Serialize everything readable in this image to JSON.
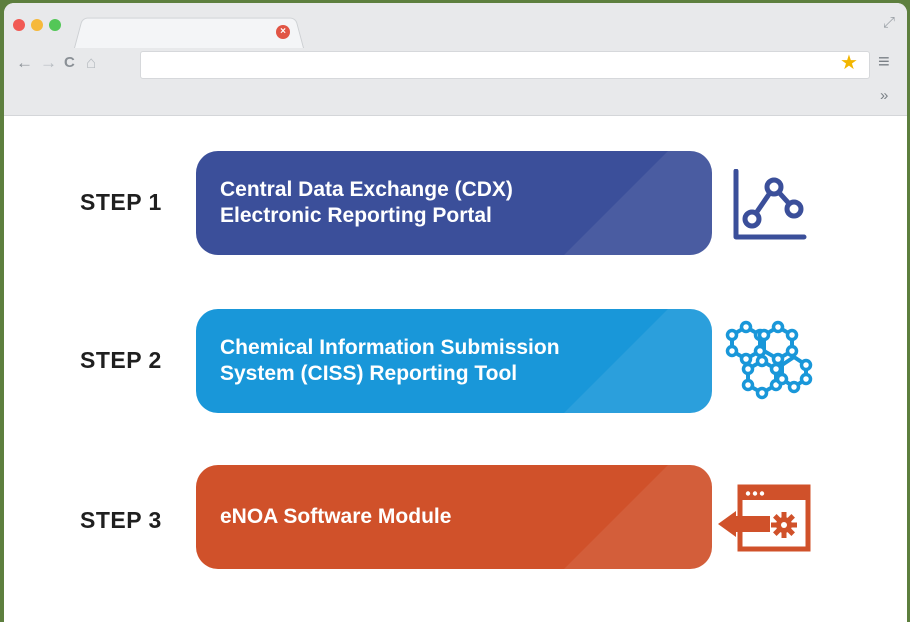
{
  "browser": {
    "tab_close_glyph": "×",
    "nav": {
      "back": "←",
      "forward": "→",
      "reload": "C",
      "home": "⌂"
    },
    "star": "★",
    "menu": "≡",
    "overflow": "»",
    "expand": "⤢"
  },
  "steps": [
    {
      "label": "STEP 1",
      "text": "Central Data Exchange (CDX)\nElectronic Reporting Portal",
      "color": "#3b4f9a",
      "icon": "chart-icon"
    },
    {
      "label": "STEP 2",
      "text": "Chemical Information Submission\nSystem (CISS) Reporting Tool",
      "color": "#1997d9",
      "icon": "molecule-network-icon"
    },
    {
      "label": "STEP 3",
      "text": "eNOA Software Module",
      "color": "#d0512a",
      "icon": "software-module-icon"
    }
  ]
}
